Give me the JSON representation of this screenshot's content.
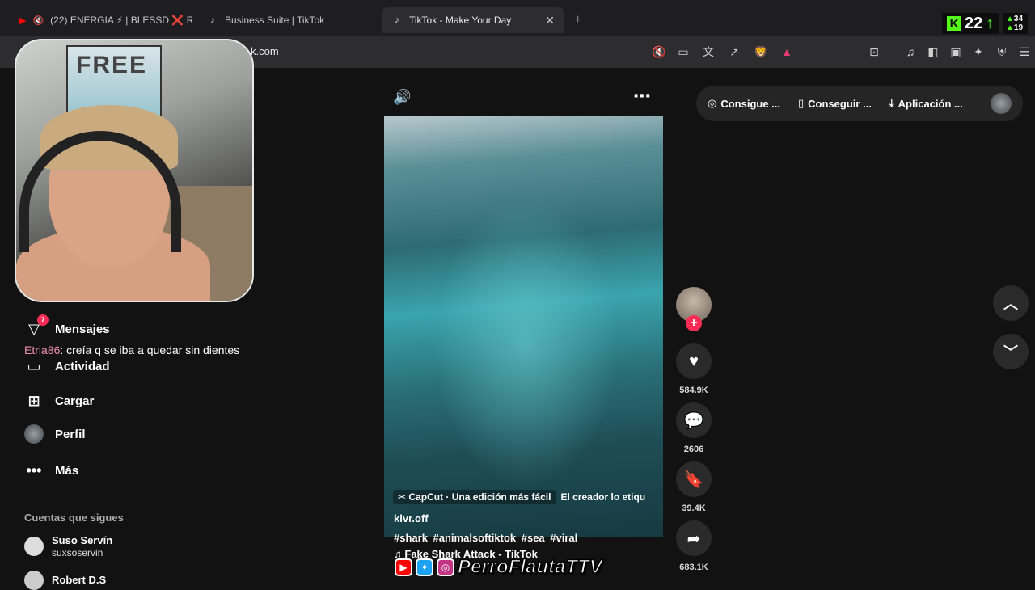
{
  "browser": {
    "tabs": [
      {
        "title": "(22) ENERGIA ⚡ | BLESSD ❌ RE",
        "icon": "youtube-icon"
      },
      {
        "title": "Business Suite | TikTok",
        "icon": "tiktok-icon"
      },
      {
        "title": "TikTok - Make Your Day",
        "icon": "tiktok-icon",
        "active": true
      }
    ],
    "url": "k.com",
    "kick_viewers": "22",
    "kick_mini_top": "34",
    "kick_mini_bottom": "19"
  },
  "sidebar": {
    "items": [
      {
        "label": "Mensajes",
        "badge": "7",
        "icon": "send-icon"
      },
      {
        "label": "Actividad",
        "badge": "",
        "icon": "activity-icon"
      },
      {
        "label": "Cargar",
        "icon": "upload-icon"
      },
      {
        "label": "Perfil",
        "icon": "profile-avatar"
      },
      {
        "label": "Más",
        "icon": "more-icon"
      }
    ],
    "following_title": "Cuentas que sigues",
    "following": [
      {
        "name": "Suso Servín",
        "handle": "suxsoservin"
      },
      {
        "name": "Robert D.S",
        "handle": ""
      }
    ]
  },
  "chat": {
    "user": "Etria86",
    "message": ": creía q se iba a quedar sin dientes"
  },
  "video": {
    "capcut": "CapCut · Una edición más fácil",
    "creator_note": "El creador lo etiqu",
    "author": "klvr.off",
    "tags": "#shark #animalsoftiktok #sea #viral",
    "music": "Fake Shark Attack - TikTok",
    "likes": "584.9K",
    "comments": "2606",
    "saves": "39.4K",
    "shares": "683.1K"
  },
  "topbar": {
    "coins": "Consigue ...",
    "app": "Conseguir ...",
    "download": "Aplicación ..."
  },
  "watermark": "PerroFlautaTTV"
}
